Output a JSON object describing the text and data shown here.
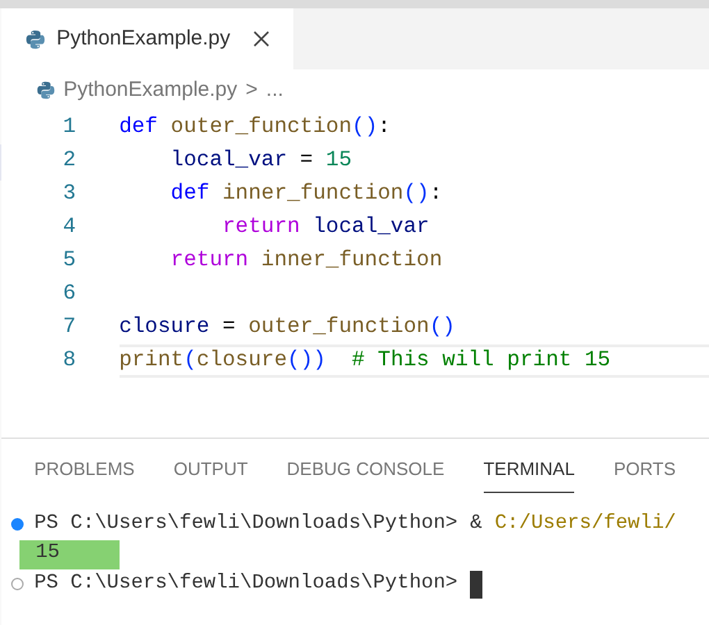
{
  "editor_tab": {
    "label": "PythonExample.py",
    "selected": true
  },
  "breadcrumb": {
    "file": "PythonExample.py",
    "separator": ">",
    "more": "..."
  },
  "code_lines": [
    {
      "number": "1",
      "tokens": [
        {
          "text": "def",
          "kind": "keyword"
        },
        {
          "text": " outer_function",
          "kind": "func"
        },
        {
          "text": "()",
          "kind": "paren"
        },
        {
          "text": ":",
          "kind": "plain"
        }
      ]
    },
    {
      "number": "2",
      "tokens": [
        {
          "text": "    local_var",
          "kind": "var"
        },
        {
          "text": " = ",
          "kind": "plain"
        },
        {
          "text": "15",
          "kind": "number"
        }
      ]
    },
    {
      "number": "3",
      "tokens": [
        {
          "text": "    def",
          "kind": "keyword"
        },
        {
          "text": " inner_function",
          "kind": "func"
        },
        {
          "text": "()",
          "kind": "paren"
        },
        {
          "text": ":",
          "kind": "plain"
        }
      ]
    },
    {
      "number": "4",
      "tokens": [
        {
          "text": "        return",
          "kind": "control"
        },
        {
          "text": " local_var",
          "kind": "var"
        }
      ]
    },
    {
      "number": "5",
      "tokens": [
        {
          "text": "    return",
          "kind": "control"
        },
        {
          "text": " inner_function",
          "kind": "func"
        }
      ]
    },
    {
      "number": "6"
    },
    {
      "number": "7",
      "tokens": [
        {
          "text": "closure",
          "kind": "var"
        },
        {
          "text": " = ",
          "kind": "plain"
        },
        {
          "text": "outer_function",
          "kind": "func"
        },
        {
          "text": "()",
          "kind": "paren"
        }
      ]
    },
    {
      "number": "8",
      "current": true,
      "tokens": [
        {
          "text": "print",
          "kind": "func"
        },
        {
          "text": "(",
          "kind": "paren"
        },
        {
          "text": "closure",
          "kind": "func"
        },
        {
          "text": "())",
          "kind": "paren"
        },
        {
          "text": "  # This will print 15",
          "kind": "comment"
        }
      ]
    }
  ],
  "panel_tabs": [
    {
      "label": "PROBLEMS",
      "selected": false
    },
    {
      "label": "OUTPUT",
      "selected": false
    },
    {
      "label": "DEBUG CONSOLE",
      "selected": false
    },
    {
      "label": "TERMINAL",
      "selected": true
    },
    {
      "label": "PORTS",
      "selected": false
    }
  ],
  "terminal_lines": [
    {
      "kind": "prompt",
      "dot_filled": true,
      "prompt": "PS C:\\Users\\fewli\\Downloads\\Python>",
      "command": "&",
      "path": "C:/Users/fewli/"
    },
    {
      "kind": "output",
      "text": "15"
    },
    {
      "kind": "prompt",
      "dot_filled": false,
      "prompt": "PS C:\\Users\\fewli\\Downloads\\Python>",
      "cursor": true
    }
  ]
}
